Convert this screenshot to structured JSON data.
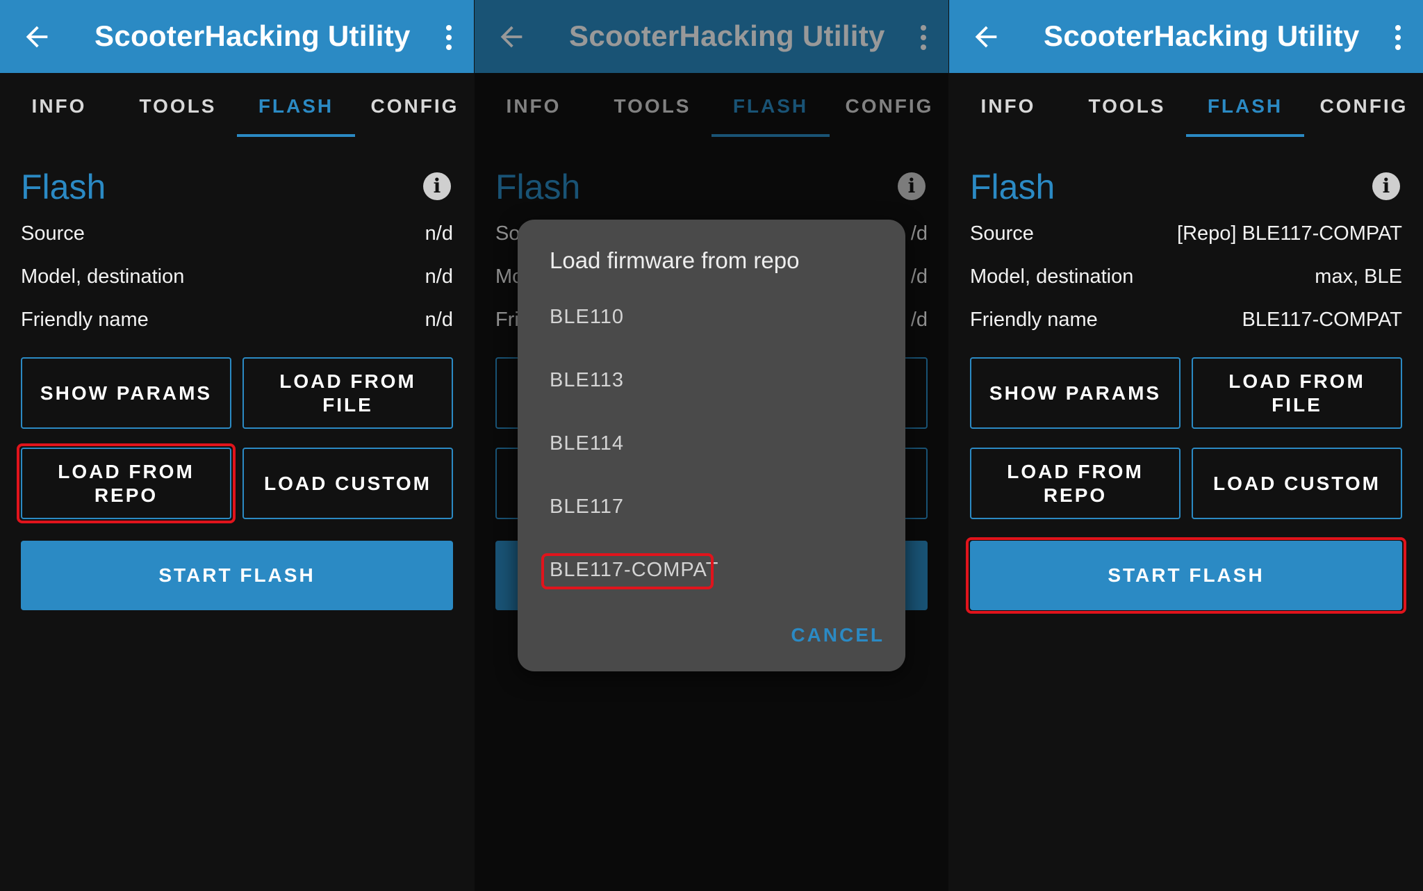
{
  "app": {
    "title": "ScooterHacking Utility"
  },
  "tabs": [
    "INFO",
    "TOOLS",
    "FLASH",
    "CONFIG"
  ],
  "flash": {
    "heading": "Flash",
    "labels": {
      "source": "Source",
      "model": "Model, destination",
      "friendly": "Friendly name"
    },
    "buttons": {
      "show_params": "SHOW PARAMS",
      "load_from_file": "LOAD FROM FILE",
      "load_from_repo": "LOAD FROM REPO",
      "load_custom": "LOAD CUSTOM",
      "start_flash": "START FLASH"
    }
  },
  "panel1": {
    "source": "n/d",
    "model": "n/d",
    "friendly": "n/d"
  },
  "panel2": {
    "source": "n/d",
    "model": "n/d",
    "friendly": "n/d",
    "partial": {
      "source": "So",
      "model": "Mo",
      "friendly": "Fri",
      "value": "/d"
    },
    "dialog": {
      "title": "Load firmware from repo",
      "items": [
        "BLE110",
        "BLE113",
        "BLE114",
        "BLE117",
        "BLE117-COMPAT"
      ],
      "cancel": "CANCEL"
    }
  },
  "panel3": {
    "source": "[Repo] BLE117-COMPAT",
    "model": "max, BLE",
    "friendly": "BLE117-COMPAT"
  },
  "colors": {
    "accent": "#2b8ac4",
    "background": "#111111",
    "highlight": "#e0141c",
    "dialog": "#4a4a4a"
  }
}
